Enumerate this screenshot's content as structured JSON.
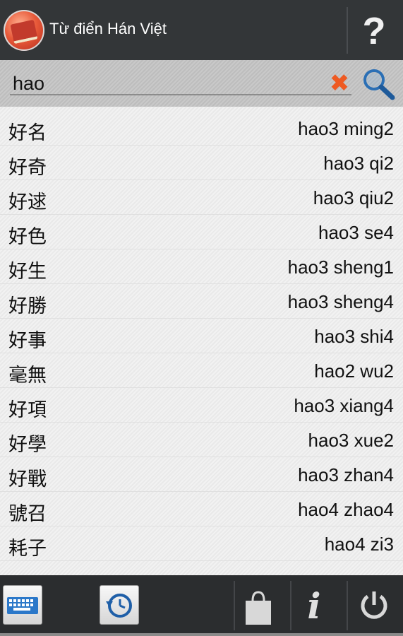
{
  "header": {
    "title": "Từ điển Hán Việt",
    "logo_icon": "dictionary-book-icon",
    "help_icon": "question-mark-icon",
    "help_glyph": "?"
  },
  "search": {
    "value": "hao",
    "clear_icon": "clear-x-icon",
    "clear_glyph": "✖",
    "search_icon": "magnifier-icon"
  },
  "results": [
    {
      "hanzi": "好名",
      "pinyin": "hao3 ming2"
    },
    {
      "hanzi": "好奇",
      "pinyin": "hao3 qi2"
    },
    {
      "hanzi": "好逑",
      "pinyin": "hao3 qiu2"
    },
    {
      "hanzi": "好色",
      "pinyin": "hao3 se4"
    },
    {
      "hanzi": "好生",
      "pinyin": "hao3 sheng1"
    },
    {
      "hanzi": "好勝",
      "pinyin": "hao3 sheng4"
    },
    {
      "hanzi": "好事",
      "pinyin": "hao3 shi4"
    },
    {
      "hanzi": "毫無",
      "pinyin": "hao2 wu2"
    },
    {
      "hanzi": "好項",
      "pinyin": "hao3 xiang4"
    },
    {
      "hanzi": "好學",
      "pinyin": "hao3 xue2"
    },
    {
      "hanzi": "好戰",
      "pinyin": "hao3 zhan4"
    },
    {
      "hanzi": "號召",
      "pinyin": "hao4 zhao4"
    },
    {
      "hanzi": "耗子",
      "pinyin": "hao4 zi3"
    }
  ],
  "bottom_bar": {
    "keyboard_icon": "keyboard-icon",
    "history_icon": "history-clock-icon",
    "store_icon": "shopping-bag-icon",
    "info_icon": "info-icon",
    "info_glyph": "i",
    "power_icon": "power-icon"
  },
  "colors": {
    "header_bg": "#333638",
    "accent_orange": "#ee5a22",
    "search_blue": "#2a6fb5"
  }
}
